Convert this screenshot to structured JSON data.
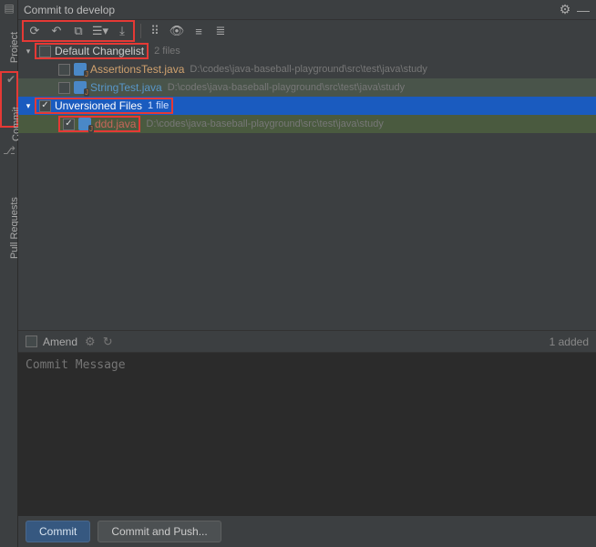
{
  "sidebar_tabs": {
    "project": "Project",
    "commit": "Commit",
    "pull_requests": "Pull Requests"
  },
  "title": "Commit to develop",
  "tree": {
    "default_changelist": {
      "label": "Default Changelist",
      "count": "2 files"
    },
    "unversioned": {
      "label": "Unversioned Files",
      "count": "1 file"
    },
    "files": {
      "assertions": {
        "name": "AssertionsTest.java",
        "path": "D:\\codes\\java-baseball-playground\\src\\test\\java\\study"
      },
      "stringtest": {
        "name": "StringTest.java",
        "path": "D:\\codes\\java-baseball-playground\\src\\test\\java\\study"
      },
      "ddd": {
        "name": "ddd.java",
        "path": "D:\\codes\\java-baseball-playground\\src\\test\\java\\study"
      }
    }
  },
  "amend": {
    "label": "Amend",
    "added": "1 added"
  },
  "message_placeholder": "Commit Message",
  "buttons": {
    "commit": "Commit",
    "commit_push": "Commit and Push..."
  }
}
